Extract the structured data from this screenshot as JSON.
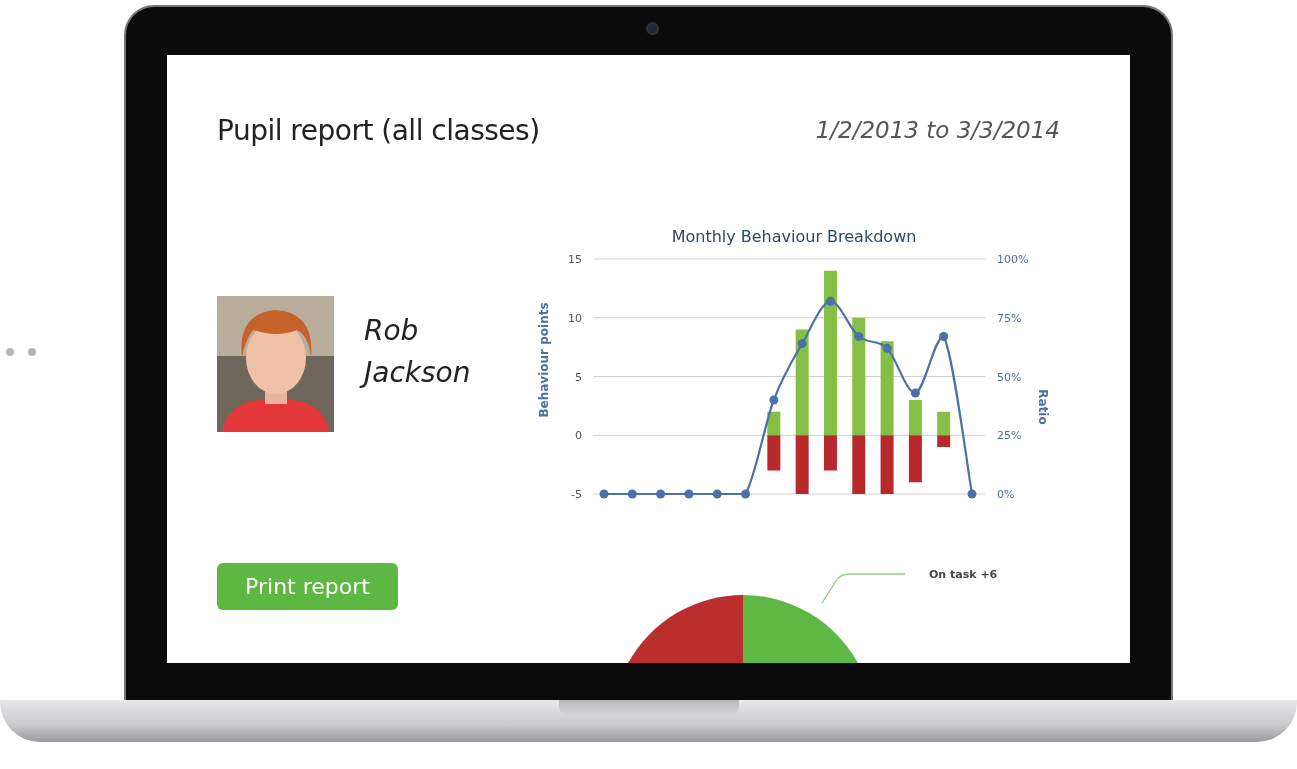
{
  "report": {
    "title": "Pupil report (all classes)",
    "date_range": "1/2/2013 to 3/3/2014"
  },
  "pupil": {
    "name": "Rob Jackson"
  },
  "print_button": "Print report",
  "chart_data": {
    "type": "bar",
    "title": "Monthly Behaviour Breakdown",
    "ylabel": "Behaviour points",
    "ylim": [
      -5,
      15
    ],
    "yticks": [
      -5,
      0,
      5,
      10,
      15
    ],
    "stacked": true,
    "grid": true,
    "series": [
      {
        "color": "#86bf45",
        "values": [
          null,
          null,
          null,
          null,
          null,
          null,
          2,
          9,
          14,
          10,
          8,
          3,
          2,
          null
        ]
      },
      {
        "color": "#b9292c",
        "values": [
          null,
          null,
          null,
          null,
          null,
          null,
          -3,
          -5,
          -3,
          -5,
          -5,
          -4,
          -1,
          null
        ]
      },
      {
        "type": "line",
        "marker": true,
        "color": "#4a72a8",
        "values": [
          -5,
          -5,
          -5,
          -5,
          -5,
          -5,
          3,
          7.8,
          11.4,
          8.4,
          7.4,
          3.6,
          8.4,
          -5
        ]
      }
    ],
    "y2label": "Ratio",
    "y2lim": [
      0,
      100
    ],
    "y2ticks": [
      {
        "value": 0,
        "label": "0%"
      },
      {
        "value": 25,
        "label": "25%"
      },
      {
        "value": 50,
        "label": "50%"
      },
      {
        "value": 75,
        "label": "75%"
      },
      {
        "value": 100,
        "label": "100%"
      }
    ]
  },
  "pie": {
    "slices": [
      {
        "label": "On task +6",
        "color": "#5fb843"
      },
      {
        "color": "#bb2e2e"
      }
    ]
  }
}
